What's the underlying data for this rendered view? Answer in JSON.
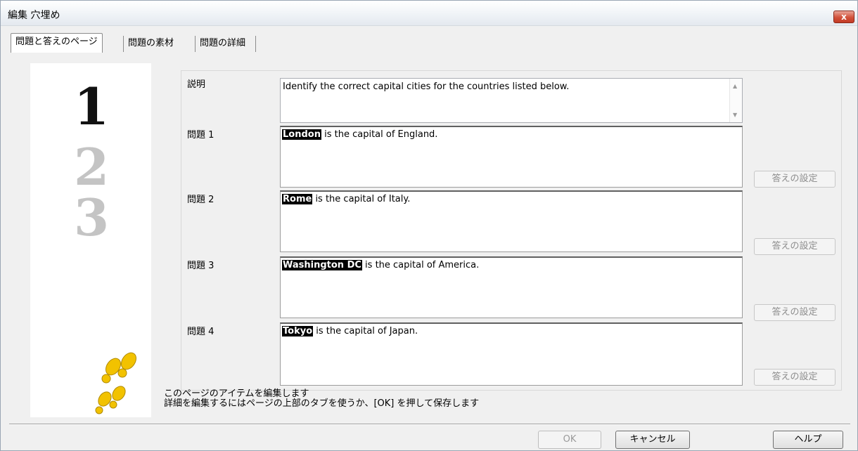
{
  "window": {
    "title": "編集 穴埋め",
    "close_glyph": "x"
  },
  "tabs": [
    {
      "label": "問題と答えのページ",
      "active": true
    },
    {
      "label": "問題の素材",
      "active": false
    },
    {
      "label": "問題の詳細",
      "active": false
    }
  ],
  "left_panel": {
    "numbers": [
      "1",
      "2",
      "3"
    ],
    "icon": "footprints-icon"
  },
  "form": {
    "description_label": "説明",
    "description_text": "Identify the correct capital cities for the countries listed below.",
    "questions": [
      {
        "label": "問題 1",
        "answer": "London",
        "rest": " is the capital of England.",
        "button": "答えの設定"
      },
      {
        "label": "問題 2",
        "answer": "Rome",
        "rest": " is the capital of Italy.",
        "button": "答えの設定"
      },
      {
        "label": "問題 3",
        "answer": "Washington DC",
        "rest": " is the capital of America.",
        "button": "答えの設定"
      },
      {
        "label": "問題 4",
        "answer": "Tokyo",
        "rest": " is the capital of Japan.",
        "button": "答えの設定"
      }
    ]
  },
  "hint": {
    "line1": "このページのアイテムを編集します",
    "line2": "詳細を編集するにはページの上部のタブを使うか、[OK] を押して保存します"
  },
  "buttons": {
    "ok": "OK",
    "cancel": "キャンセル",
    "help": "ヘルプ"
  },
  "colors": {
    "highlight": "#000000",
    "footprint": "#f2c200",
    "faded_number": "#c4c4c4"
  }
}
